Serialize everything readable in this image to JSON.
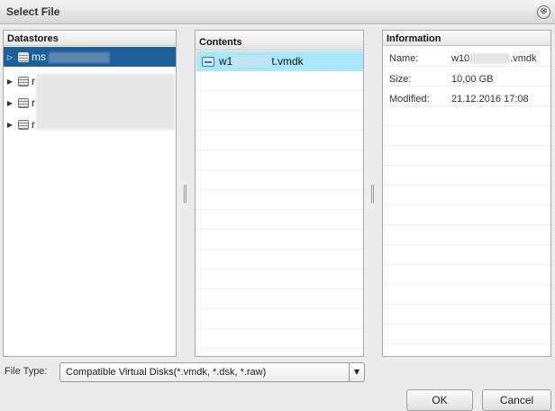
{
  "dialog": {
    "title": "Select File",
    "close_glyph": "⊗"
  },
  "datastores": {
    "header": "Datastores",
    "items": [
      {
        "label": "ms",
        "expander": "▷",
        "selected": true,
        "icon": "database-icon"
      },
      {
        "label": "r",
        "expander": "▶",
        "selected": false,
        "icon": "database-icon"
      },
      {
        "label": "r",
        "expander": "▶",
        "selected": false,
        "icon": "database-icon"
      },
      {
        "label": "r",
        "expander": "▶",
        "selected": false,
        "icon": "database-icon"
      }
    ]
  },
  "contents": {
    "header": "Contents",
    "files": [
      {
        "name_prefix": "w1",
        "name_suffix": "t.vmdk",
        "icon": "vmdk-disk-icon",
        "selected": true
      }
    ]
  },
  "information": {
    "header": "Information",
    "rows": [
      {
        "key": "Name:",
        "value_prefix": "w10",
        "value_suffix": ".vmdk"
      },
      {
        "key": "Size:",
        "value": "10,00 GB"
      },
      {
        "key": "Modified:",
        "value": "21.12.2016 17:08"
      }
    ]
  },
  "footer": {
    "file_type_label": "File Type:",
    "file_type_value": "Compatible Virtual Disks(*.vmdk, *.dsk, *.raw)",
    "dropdown_arrow": "▼",
    "ok_label": "OK",
    "cancel_label": "Cancel"
  },
  "colors": {
    "selection_tree": "#1d5f9a",
    "selection_contents": "#a9e7fb"
  }
}
